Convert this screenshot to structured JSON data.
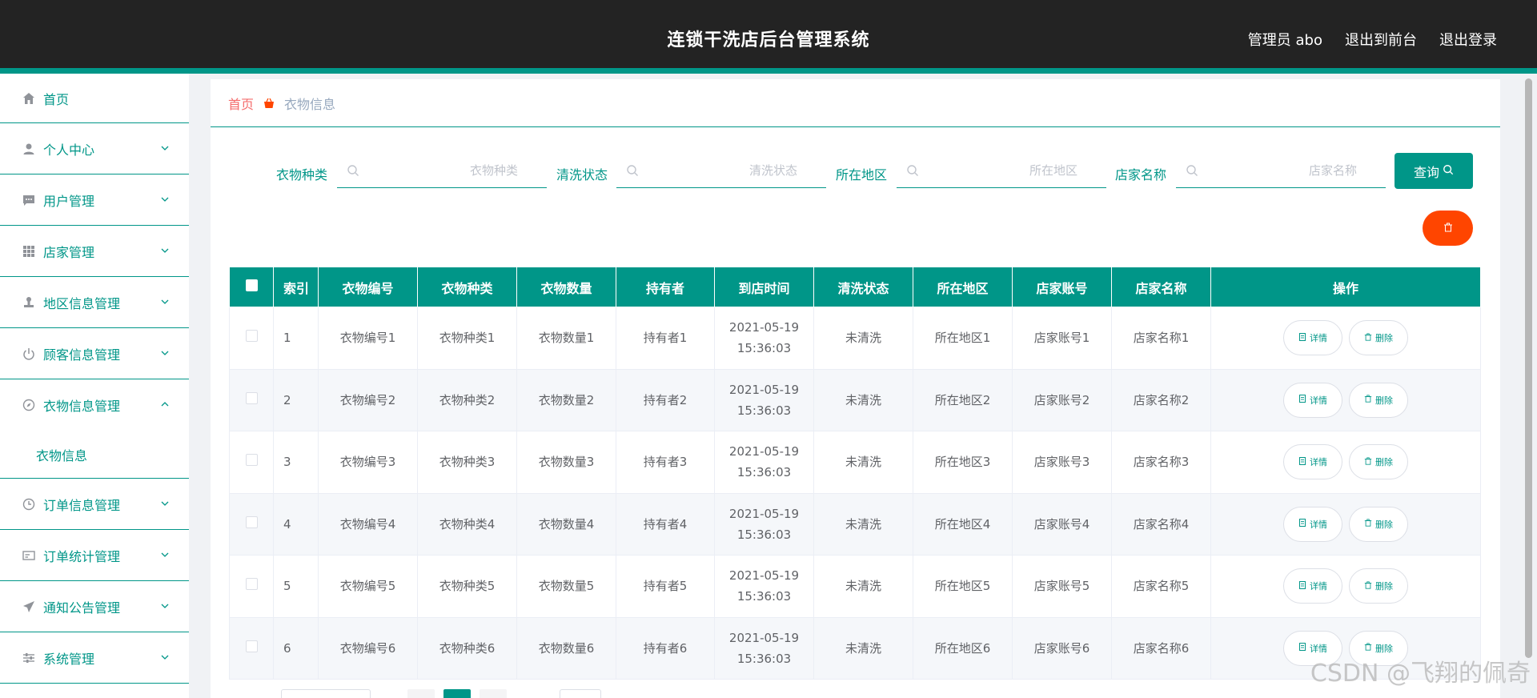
{
  "header": {
    "title": "连锁干洗店后台管理系统",
    "admin": "管理员 abo",
    "to_front": "退出到前台",
    "logout": "退出登录"
  },
  "sidebar": {
    "items": [
      {
        "label": "首页",
        "icon": "home-icon"
      },
      {
        "label": "个人中心",
        "icon": "user-icon"
      },
      {
        "label": "用户管理",
        "icon": "chat-icon"
      },
      {
        "label": "店家管理",
        "icon": "grid-icon"
      },
      {
        "label": "地区信息管理",
        "icon": "stamp-icon"
      },
      {
        "label": "顾客信息管理",
        "icon": "power-icon"
      },
      {
        "label": "衣物信息管理",
        "icon": "compass-icon",
        "expanded": true,
        "sub": "衣物信息"
      },
      {
        "label": "订单信息管理",
        "icon": "clock-icon"
      },
      {
        "label": "订单统计管理",
        "icon": "card-icon"
      },
      {
        "label": "通知公告管理",
        "icon": "send-icon"
      },
      {
        "label": "系统管理",
        "icon": "sliders-icon"
      }
    ]
  },
  "breadcrumb": {
    "home": "首页",
    "current": "衣物信息"
  },
  "search": {
    "fields": [
      {
        "label": "衣物种类",
        "placeholder": "衣物种类"
      },
      {
        "label": "清洗状态",
        "placeholder": "清洗状态"
      },
      {
        "label": "所在地区",
        "placeholder": "所在地区"
      },
      {
        "label": "店家名称",
        "placeholder": "店家名称"
      }
    ],
    "query_label": "查询"
  },
  "table": {
    "columns": [
      "索引",
      "衣物编号",
      "衣物种类",
      "衣物数量",
      "持有者",
      "到店时间",
      "清洗状态",
      "所在地区",
      "店家账号",
      "店家名称",
      "操作"
    ],
    "rows": [
      [
        "1",
        "衣物编号1",
        "衣物种类1",
        "衣物数量1",
        "持有者1",
        "2021-05-19 15:36:03",
        "未清洗",
        "所在地区1",
        "店家账号1",
        "店家名称1"
      ],
      [
        "2",
        "衣物编号2",
        "衣物种类2",
        "衣物数量2",
        "持有者2",
        "2021-05-19 15:36:03",
        "未清洗",
        "所在地区2",
        "店家账号2",
        "店家名称2"
      ],
      [
        "3",
        "衣物编号3",
        "衣物种类3",
        "衣物数量3",
        "持有者3",
        "2021-05-19 15:36:03",
        "未清洗",
        "所在地区3",
        "店家账号3",
        "店家名称3"
      ],
      [
        "4",
        "衣物编号4",
        "衣物种类4",
        "衣物数量4",
        "持有者4",
        "2021-05-19 15:36:03",
        "未清洗",
        "所在地区4",
        "店家账号4",
        "店家名称4"
      ],
      [
        "5",
        "衣物编号5",
        "衣物种类5",
        "衣物数量5",
        "持有者5",
        "2021-05-19 15:36:03",
        "未清洗",
        "所在地区5",
        "店家账号5",
        "店家名称5"
      ],
      [
        "6",
        "衣物编号6",
        "衣物种类6",
        "衣物数量6",
        "持有者6",
        "2021-05-19 15:36:03",
        "未清洗",
        "所在地区6",
        "店家账号6",
        "店家名称6"
      ]
    ],
    "detail_label": "详情",
    "delete_label": "删除"
  },
  "watermark": "CSDN @飞翔的佩奇",
  "colors": {
    "primary": "#009688",
    "header_bg": "#232323",
    "danger": "#ff4500",
    "breadcrumb_home": "#f56c6c"
  }
}
